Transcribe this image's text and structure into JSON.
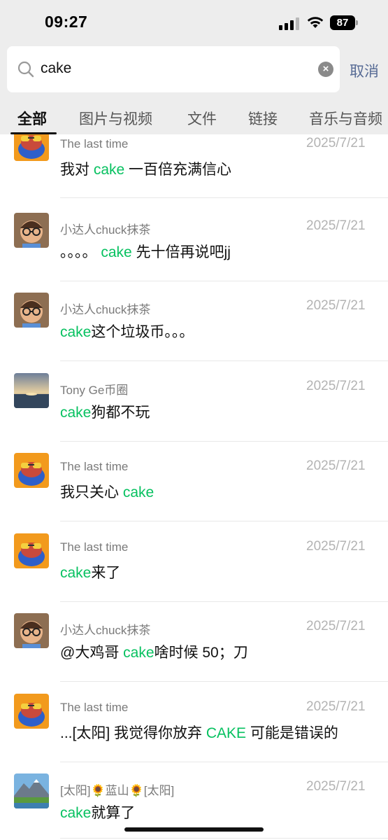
{
  "status": {
    "time": "09:27",
    "battery": "87"
  },
  "search": {
    "query": "cake",
    "cancel_label": "取消"
  },
  "tabs": [
    "全部",
    "图片与视频",
    "文件",
    "链接",
    "音乐与音频"
  ],
  "results": [
    {
      "name": "The last time",
      "date": "2025/7/21",
      "avatar": "frog-avatar",
      "pre": "我对 ",
      "hl": "cake",
      "post": " 一百倍充满信心"
    },
    {
      "name": "小达人chuck抹茶",
      "date": "2025/7/21",
      "avatar": "glasses-man-avatar",
      "pre": "。。。。 ",
      "hl": "cake",
      "post": " 先十倍再说吧jj"
    },
    {
      "name": "小达人chuck抹茶",
      "date": "2025/7/21",
      "avatar": "glasses-man-avatar",
      "pre": "",
      "hl": "cake",
      "post": "这个垃圾币。。。"
    },
    {
      "name": "Tony Ge币圈",
      "date": "2025/7/21",
      "avatar": "sunset-avatar",
      "pre": "",
      "hl": "cake",
      "post": "狗都不玩"
    },
    {
      "name": "The last time",
      "date": "2025/7/21",
      "avatar": "frog-avatar",
      "pre": "我只关心 ",
      "hl": "cake",
      "post": ""
    },
    {
      "name": "The last time",
      "date": "2025/7/21",
      "avatar": "frog-avatar",
      "pre": "",
      "hl": "cake",
      "post": "来了"
    },
    {
      "name": "小达人chuck抹茶",
      "date": "2025/7/21",
      "avatar": "glasses-man-avatar",
      "pre": "@大鸡哥 ",
      "hl": "cake",
      "post": "啥时候 50；刀"
    },
    {
      "name": "The last time",
      "date": "2025/7/21",
      "avatar": "frog-avatar",
      "pre": "...[太阳] 我觉得你放弃 ",
      "hl": "CAKE",
      "post": " 可能是错误的"
    },
    {
      "name": "[太阳]🌻蓝山🌻[太阳]",
      "date": "2025/7/21",
      "avatar": "mountain-avatar",
      "pre": "",
      "hl": "cake",
      "post": "就算了"
    }
  ],
  "colors": {
    "highlight": "#07c160",
    "cancel": "#576b95",
    "header_bg": "#ededed"
  }
}
